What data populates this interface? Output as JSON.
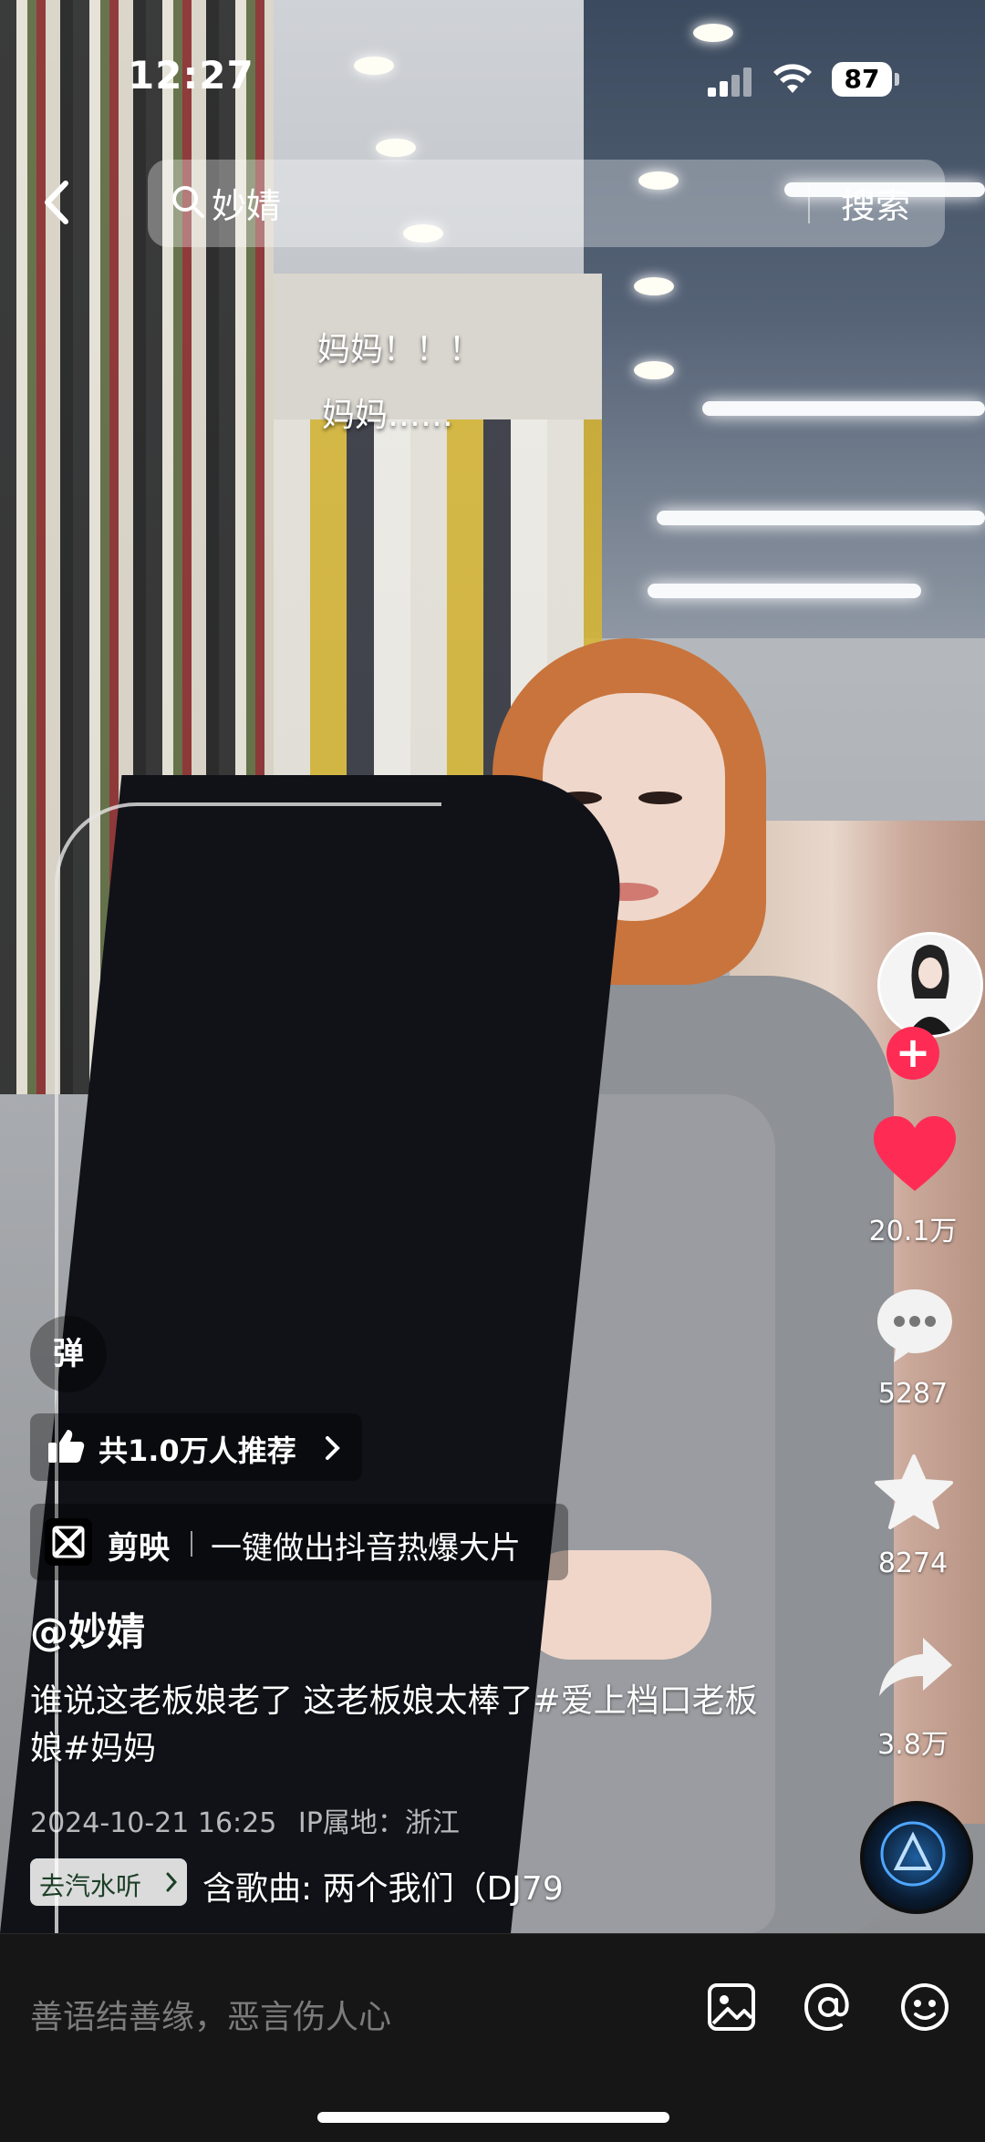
{
  "status_bar": {
    "time": "12:27",
    "battery": "87"
  },
  "search": {
    "query": "妙婧",
    "button_label": "搜索"
  },
  "video_captions": [
    "妈妈！！！",
    "妈妈……"
  ],
  "right_rail": {
    "likes": "20.1万",
    "comments": "5287",
    "favorites": "8274",
    "shares": "3.8万",
    "follow_symbol": "+"
  },
  "overlay": {
    "danmu_label": "弹",
    "recommend_label": "共1.0万人推荐",
    "jianying_brand": "剪映",
    "jianying_slogan": "一键做出抖音热爆大片",
    "author": "@妙婧",
    "description": "谁说这老板娘老了 这老板娘太棒了#爱上档口老板娘#妈妈",
    "date": "2024-10-21 16:25",
    "ip_location": "IP属地：浙江",
    "music_tag": "去汽水听",
    "music_song": "含歌曲: 两个我们（DJ79"
  },
  "comment_bar": {
    "placeholder": "善语结善缘，恶言伤人心"
  },
  "colors": {
    "like_red": "#fe2c55",
    "follow_red": "#fe2c55",
    "background": "#161616"
  }
}
